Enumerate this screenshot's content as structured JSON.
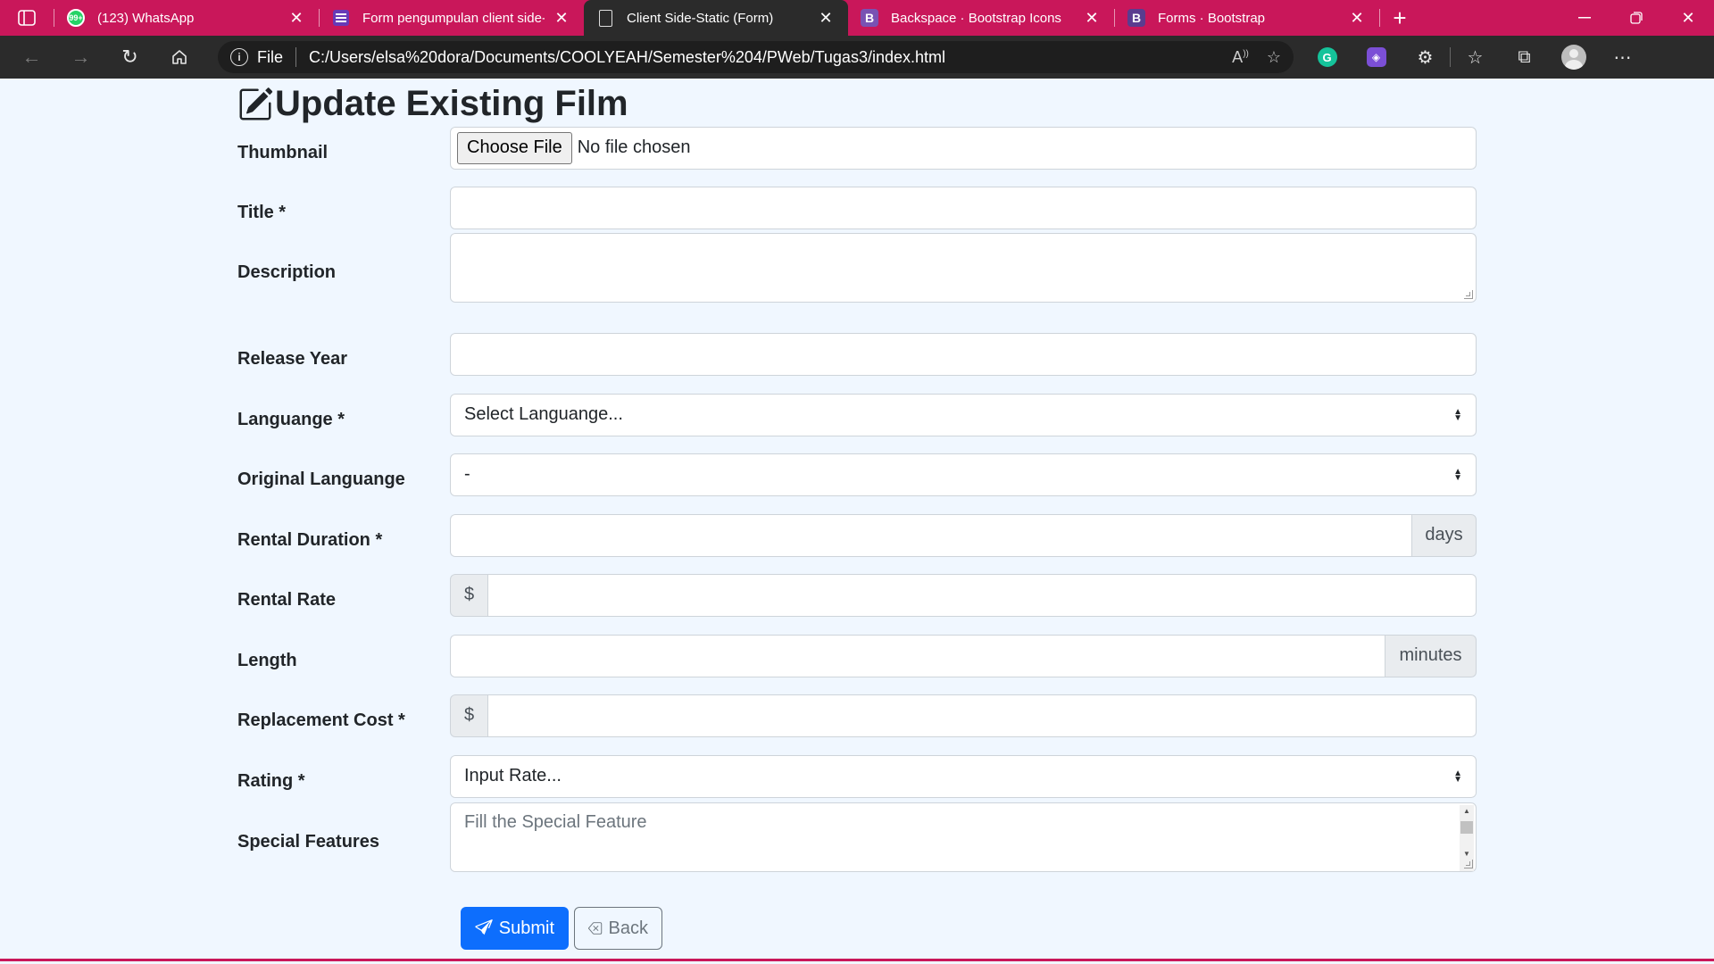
{
  "browser": {
    "tabs": [
      {
        "title": "(123) WhatsApp",
        "icon": "whatsapp-icon",
        "active": false
      },
      {
        "title": "Form pengumpulan client side-s",
        "icon": "google-forms-icon",
        "active": false
      },
      {
        "title": "Client Side-Static (Form)",
        "icon": "document-icon",
        "active": true
      },
      {
        "title": "Backspace · Bootstrap Icons",
        "icon": "bootstrap-icon",
        "active": false
      },
      {
        "title": "Forms · Bootstrap",
        "icon": "bootstrap-icon",
        "active": false
      }
    ],
    "whatsapp_badge": "99+",
    "address": {
      "scheme_label": "File",
      "url": "C:/Users/elsa%20dora/Documents/COOLYEAH/Semester%204/PWeb/Tugas3/index.html"
    },
    "grammarly_letter": "G"
  },
  "form": {
    "heading": "Update Existing Film",
    "fields": {
      "thumbnail": {
        "label": "Thumbnail",
        "button": "Choose File",
        "status": "No file chosen"
      },
      "title": {
        "label": "Title *",
        "value": ""
      },
      "description": {
        "label": "Description",
        "value": ""
      },
      "release_year": {
        "label": "Release Year",
        "value": ""
      },
      "language": {
        "label": "Languange *",
        "selected": "Select Languange..."
      },
      "original_language": {
        "label": "Original Languange",
        "selected": "-"
      },
      "rental_duration": {
        "label": "Rental Duration *",
        "value": "",
        "suffix": "days"
      },
      "rental_rate": {
        "label": "Rental Rate",
        "value": "",
        "prefix": "$"
      },
      "length": {
        "label": "Length",
        "value": "",
        "suffix": "minutes"
      },
      "replacement_cost": {
        "label": "Replacement Cost *",
        "value": "",
        "prefix": "$"
      },
      "rating": {
        "label": "Rating *",
        "selected": "Input Rate..."
      },
      "special_features": {
        "label": "Special Features",
        "placeholder": "Fill the Special Feature"
      }
    },
    "buttons": {
      "submit": "Submit",
      "back": "Back"
    }
  },
  "colors": {
    "tab_bar": "#c9175a",
    "toolbar": "#2b2b2b",
    "page_bg": "#f0f7ff",
    "primary": "#0d6efd",
    "secondary": "#6c757d"
  }
}
